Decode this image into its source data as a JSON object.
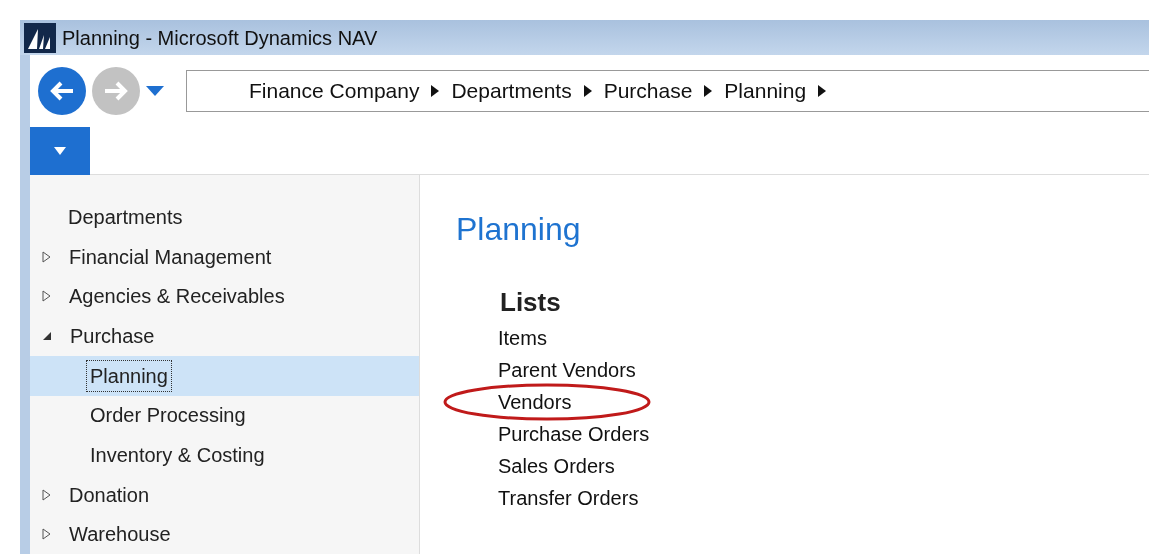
{
  "window": {
    "title": "Planning - Microsoft Dynamics NAV"
  },
  "breadcrumb": [
    "Finance Company",
    "Departments",
    "Purchase",
    "Planning"
  ],
  "sidebar": {
    "heading": "Departments",
    "items": [
      {
        "label": "Financial Management",
        "expanded": false
      },
      {
        "label": "Agencies & Receivables",
        "expanded": false
      },
      {
        "label": "Purchase",
        "expanded": true,
        "children": [
          {
            "label": "Planning",
            "selected": true
          },
          {
            "label": "Order Processing",
            "selected": false
          },
          {
            "label": "Inventory & Costing",
            "selected": false
          }
        ]
      },
      {
        "label": "Donation",
        "expanded": false
      },
      {
        "label": "Warehouse",
        "expanded": false
      }
    ]
  },
  "page": {
    "title": "Planning",
    "section": "Lists",
    "links": [
      {
        "label": "Items",
        "circled": false
      },
      {
        "label": "Parent Vendors",
        "circled": false
      },
      {
        "label": "Vendors",
        "circled": true
      },
      {
        "label": "Purchase Orders",
        "circled": false
      },
      {
        "label": "Sales Orders",
        "circled": false
      },
      {
        "label": "Transfer Orders",
        "circled": false
      }
    ]
  }
}
